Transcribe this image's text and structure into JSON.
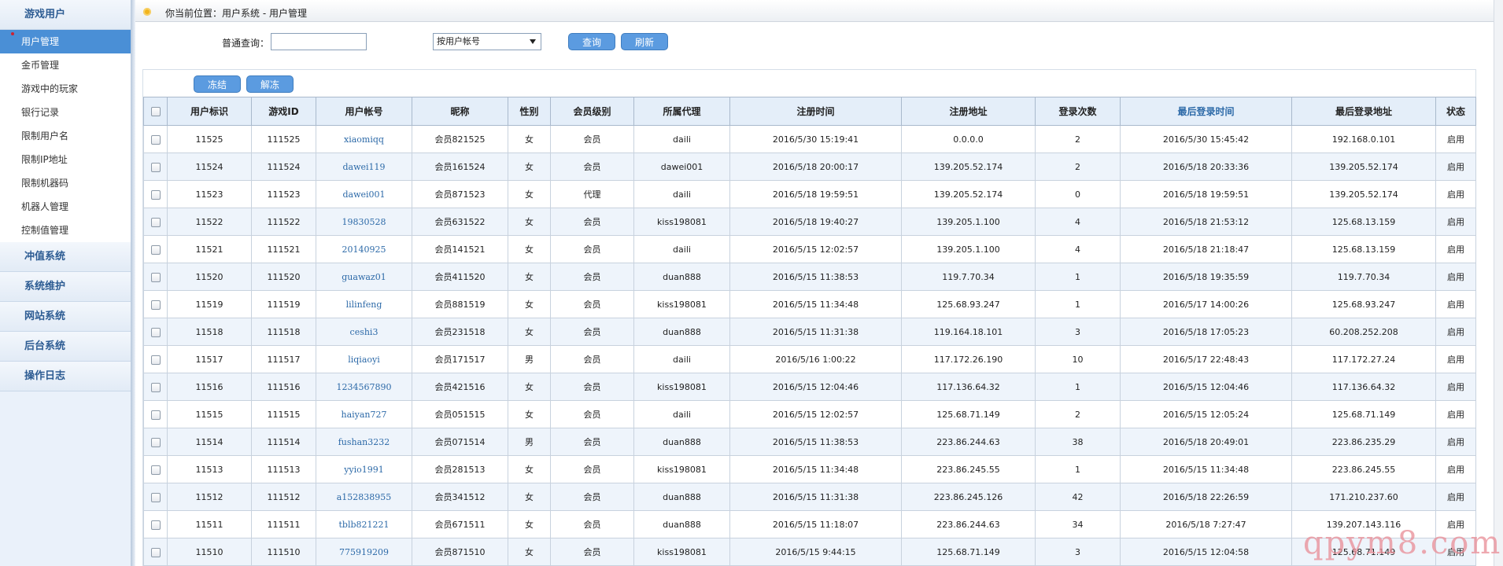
{
  "sidebar": {
    "sections": [
      {
        "label": "游戏用户",
        "items": [
          {
            "label": "用户管理",
            "active": true
          },
          {
            "label": "金币管理"
          },
          {
            "label": "游戏中的玩家"
          },
          {
            "label": "银行记录"
          },
          {
            "label": "限制用户名"
          },
          {
            "label": "限制IP地址"
          },
          {
            "label": "限制机器码"
          },
          {
            "label": "机器人管理"
          },
          {
            "label": "控制值管理"
          }
        ]
      },
      {
        "label": "冲值系统",
        "items": []
      },
      {
        "label": "系统维护",
        "items": []
      },
      {
        "label": "网站系统",
        "items": []
      },
      {
        "label": "后台系统",
        "items": []
      },
      {
        "label": "操作日志",
        "items": []
      }
    ]
  },
  "breadcrumb": "你当前位置：用户系统 - 用户管理",
  "query": {
    "label": "普通查询：",
    "input_value": "",
    "select_value": "按用户帐号",
    "search_label": "查询",
    "refresh_label": "刷新"
  },
  "actions": {
    "freeze_label": "冻结",
    "unfreeze_label": "解冻"
  },
  "table": {
    "headers": [
      "用户标识",
      "游戏ID",
      "用户帐号",
      "昵称",
      "性别",
      "会员级别",
      "所属代理",
      "注册时间",
      "注册地址",
      "登录次数",
      "最后登录时间",
      "最后登录地址",
      "状态"
    ],
    "rows": [
      [
        "11525",
        "111525",
        "xiaomiqq",
        "会员821525",
        "女",
        "会员",
        "daili",
        "2016/5/30 15:19:41",
        "0.0.0.0",
        "2",
        "2016/5/30 15:45:42",
        "192.168.0.101",
        "启用"
      ],
      [
        "11524",
        "111524",
        "dawei119",
        "会员161524",
        "女",
        "会员",
        "dawei001",
        "2016/5/18 20:00:17",
        "139.205.52.174",
        "2",
        "2016/5/18 20:33:36",
        "139.205.52.174",
        "启用"
      ],
      [
        "11523",
        "111523",
        "dawei001",
        "会员871523",
        "女",
        "代理",
        "daili",
        "2016/5/18 19:59:51",
        "139.205.52.174",
        "0",
        "2016/5/18 19:59:51",
        "139.205.52.174",
        "启用"
      ],
      [
        "11522",
        "111522",
        "19830528",
        "会员631522",
        "女",
        "会员",
        "kiss198081",
        "2016/5/18 19:40:27",
        "139.205.1.100",
        "4",
        "2016/5/18 21:53:12",
        "125.68.13.159",
        "启用"
      ],
      [
        "11521",
        "111521",
        "20140925",
        "会员141521",
        "女",
        "会员",
        "daili",
        "2016/5/15 12:02:57",
        "139.205.1.100",
        "4",
        "2016/5/18 21:18:47",
        "125.68.13.159",
        "启用"
      ],
      [
        "11520",
        "111520",
        "guawaz01",
        "会员411520",
        "女",
        "会员",
        "duan888",
        "2016/5/15 11:38:53",
        "119.7.70.34",
        "1",
        "2016/5/18 19:35:59",
        "119.7.70.34",
        "启用"
      ],
      [
        "11519",
        "111519",
        "lilinfeng",
        "会员881519",
        "女",
        "会员",
        "kiss198081",
        "2016/5/15 11:34:48",
        "125.68.93.247",
        "1",
        "2016/5/17 14:00:26",
        "125.68.93.247",
        "启用"
      ],
      [
        "11518",
        "111518",
        "ceshi3",
        "会员231518",
        "女",
        "会员",
        "duan888",
        "2016/5/15 11:31:38",
        "119.164.18.101",
        "3",
        "2016/5/18 17:05:23",
        "60.208.252.208",
        "启用"
      ],
      [
        "11517",
        "111517",
        "liqiaoyi",
        "会员171517",
        "男",
        "会员",
        "daili",
        "2016/5/16 1:00:22",
        "117.172.26.190",
        "10",
        "2016/5/17 22:48:43",
        "117.172.27.24",
        "启用"
      ],
      [
        "11516",
        "111516",
        "1234567890",
        "会员421516",
        "女",
        "会员",
        "kiss198081",
        "2016/5/15 12:04:46",
        "117.136.64.32",
        "1",
        "2016/5/15 12:04:46",
        "117.136.64.32",
        "启用"
      ],
      [
        "11515",
        "111515",
        "haiyan727",
        "会员051515",
        "女",
        "会员",
        "daili",
        "2016/5/15 12:02:57",
        "125.68.71.149",
        "2",
        "2016/5/15 12:05:24",
        "125.68.71.149",
        "启用"
      ],
      [
        "11514",
        "111514",
        "fushan3232",
        "会员071514",
        "男",
        "会员",
        "duan888",
        "2016/5/15 11:38:53",
        "223.86.244.63",
        "38",
        "2016/5/18 20:49:01",
        "223.86.235.29",
        "启用"
      ],
      [
        "11513",
        "111513",
        "yyio1991",
        "会员281513",
        "女",
        "会员",
        "kiss198081",
        "2016/5/15 11:34:48",
        "223.86.245.55",
        "1",
        "2016/5/15 11:34:48",
        "223.86.245.55",
        "启用"
      ],
      [
        "11512",
        "111512",
        "a152838955",
        "会员341512",
        "女",
        "会员",
        "duan888",
        "2016/5/15 11:31:38",
        "223.86.245.126",
        "42",
        "2016/5/18 22:26:59",
        "171.210.237.60",
        "启用"
      ],
      [
        "11511",
        "111511",
        "tblb821221",
        "会员671511",
        "女",
        "会员",
        "duan888",
        "2016/5/15 11:18:07",
        "223.86.244.63",
        "34",
        "2016/5/18 7:27:47",
        "139.207.143.116",
        "启用"
      ],
      [
        "11510",
        "111510",
        "775919209",
        "会员871510",
        "女",
        "会员",
        "kiss198081",
        "2016/5/15 9:44:15",
        "125.68.71.149",
        "3",
        "2016/5/15 12:04:58",
        "125.68.71.149",
        "启用"
      ]
    ]
  },
  "watermark": "qpym8.com",
  "colors": {
    "accent": "#4a8fd6",
    "header_bg": "#e4eef9",
    "link": "#2d6aa8"
  }
}
